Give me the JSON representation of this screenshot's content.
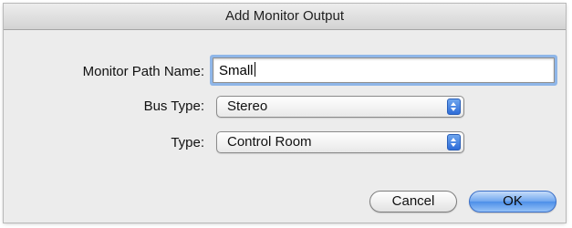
{
  "window": {
    "title": "Add Monitor Output"
  },
  "form": {
    "monitor_path_name_label": "Monitor Path Name:",
    "monitor_path_name_value": "Small",
    "bus_type_label": "Bus Type:",
    "bus_type_value": "Stereo",
    "type_label": "Type:",
    "type_value": "Control Room"
  },
  "buttons": {
    "cancel_label": "Cancel",
    "ok_label": "OK"
  },
  "colors": {
    "focus_ring": "#8fb6e8",
    "default_button": "#6ea6ef",
    "popup_arrow": "#2e6cd8"
  }
}
